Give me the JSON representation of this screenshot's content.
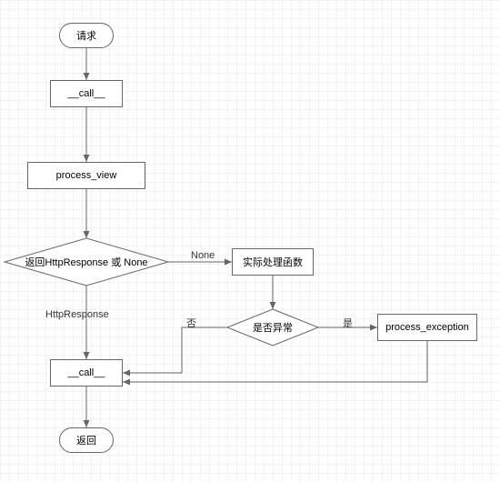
{
  "chart_data": {
    "type": "flowchart",
    "nodes": [
      {
        "id": "start",
        "kind": "terminator",
        "label": "请求"
      },
      {
        "id": "call1",
        "kind": "process",
        "label": "__call__"
      },
      {
        "id": "pview",
        "kind": "process",
        "label": "process_view"
      },
      {
        "id": "dec1",
        "kind": "decision",
        "label": "返回HttpResponse 或 None"
      },
      {
        "id": "handler",
        "kind": "process",
        "label": "实际处理函数"
      },
      {
        "id": "dec2",
        "kind": "decision",
        "label": "是否异常"
      },
      {
        "id": "pexc",
        "kind": "process",
        "label": "process_exception"
      },
      {
        "id": "call2",
        "kind": "process",
        "label": "__call__"
      },
      {
        "id": "end",
        "kind": "terminator",
        "label": "返回"
      }
    ],
    "edges": [
      {
        "from": "start",
        "to": "call1",
        "label": ""
      },
      {
        "from": "call1",
        "to": "pview",
        "label": ""
      },
      {
        "from": "pview",
        "to": "dec1",
        "label": ""
      },
      {
        "from": "dec1",
        "to": "handler",
        "label": "None"
      },
      {
        "from": "dec1",
        "to": "call2",
        "label": "HttpResponse"
      },
      {
        "from": "handler",
        "to": "dec2",
        "label": ""
      },
      {
        "from": "dec2",
        "to": "pexc",
        "label": "是"
      },
      {
        "from": "dec2",
        "to": "call2",
        "label": "否"
      },
      {
        "from": "pexc",
        "to": "call2",
        "label": ""
      },
      {
        "from": "call2",
        "to": "end",
        "label": ""
      }
    ]
  },
  "nodes": {
    "start": {
      "label": "请求"
    },
    "call1": {
      "label": "__call__"
    },
    "pview": {
      "label": "process_view"
    },
    "dec1": {
      "label": "返回HttpResponse 或 None"
    },
    "handler": {
      "label": "实际处理函数"
    },
    "dec2": {
      "label": "是否异常"
    },
    "pexc": {
      "label": "process_exception"
    },
    "call2": {
      "label": "__call__"
    },
    "end": {
      "label": "返回"
    }
  },
  "edge_labels": {
    "dec1_handler": "None",
    "dec1_call2": "HttpResponse",
    "dec2_pexc": "是",
    "dec2_call2": "否"
  }
}
